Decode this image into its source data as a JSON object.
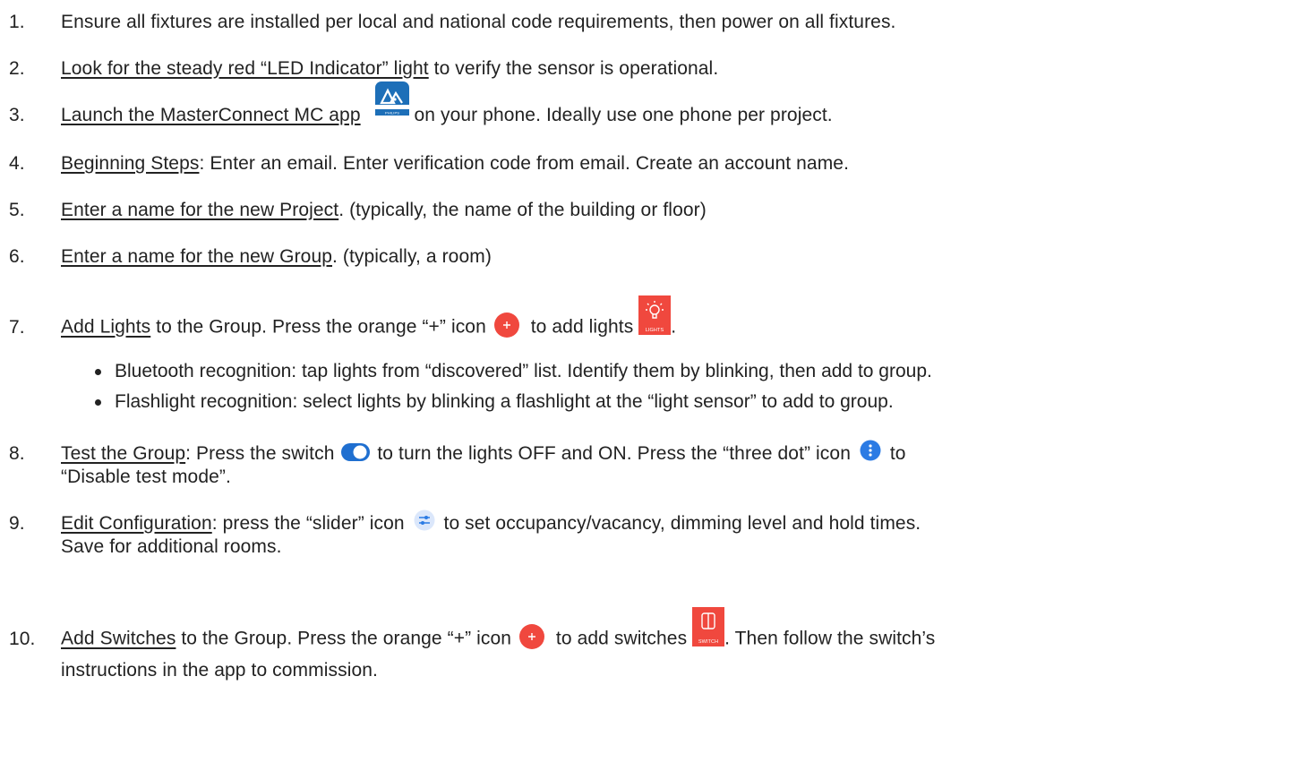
{
  "steps": [
    {
      "num": "1.",
      "text": "Ensure all fixtures are installed per local and national code requirements, then power on all fixtures."
    },
    {
      "num": "2.",
      "link": "Look for the steady red “LED Indicator” light",
      "rest": " to verify the sensor is operational."
    },
    {
      "num": "3.",
      "link": "Launch the MasterConnect MC app",
      "rest": " on your phone.  Ideally use one phone per project.",
      "icon_label": "PHILIPS"
    },
    {
      "num": "4.",
      "link": "Beginning Steps",
      "rest": ": Enter an email. Enter verification code from email. Create an account name."
    },
    {
      "num": "5.",
      "link": "Enter a name for the new Project",
      "rest": ". (typically, the name of the building or floor)"
    },
    {
      "num": "6.",
      "link": "Enter a name for the new Group",
      "rest": ". (typically, a room)"
    },
    {
      "num": "7.",
      "link": "Add Lights",
      "mid": " to the Group.  Press the orange “+” icon ",
      "mid2": " to add lights ",
      "end": ".",
      "icon_label": "LIGHTS"
    },
    {
      "num": "8.",
      "link": "Test the Group",
      "mid": ": Press the switch ",
      "mid2": " to turn the lights OFF and ON. Press the “three dot” icon ",
      "mid3": " to",
      "line2": "“Disable test mode”."
    },
    {
      "num": "9.",
      "link": "Edit Configuration",
      "mid": ": press the “slider” icon ",
      "mid2": " to set occupancy/vacancy, dimming level and hold times.",
      "line2": "Save for additional rooms."
    },
    {
      "num": "10.",
      "link": "Add Switches",
      "mid": " to the Group. Press the orange “+” icon ",
      "mid2": " to add switches ",
      "mid3": ". Then follow the switch’s",
      "line2": "instructions in the app to commission.",
      "icon_label": "SWITCH"
    }
  ],
  "bullets": [
    "Bluetooth recognition: tap lights from “discovered” list. Identify them by blinking, then add to group.",
    "Flashlight recognition: select lights by blinking a flashlight at the “light sensor” to add to group."
  ],
  "colors": {
    "text": "#222222",
    "orange": "#f0483e",
    "app_blue": "#1d6fb8",
    "toggle_blue": "#1f6fd0",
    "dot_blue": "#2b7be4"
  }
}
